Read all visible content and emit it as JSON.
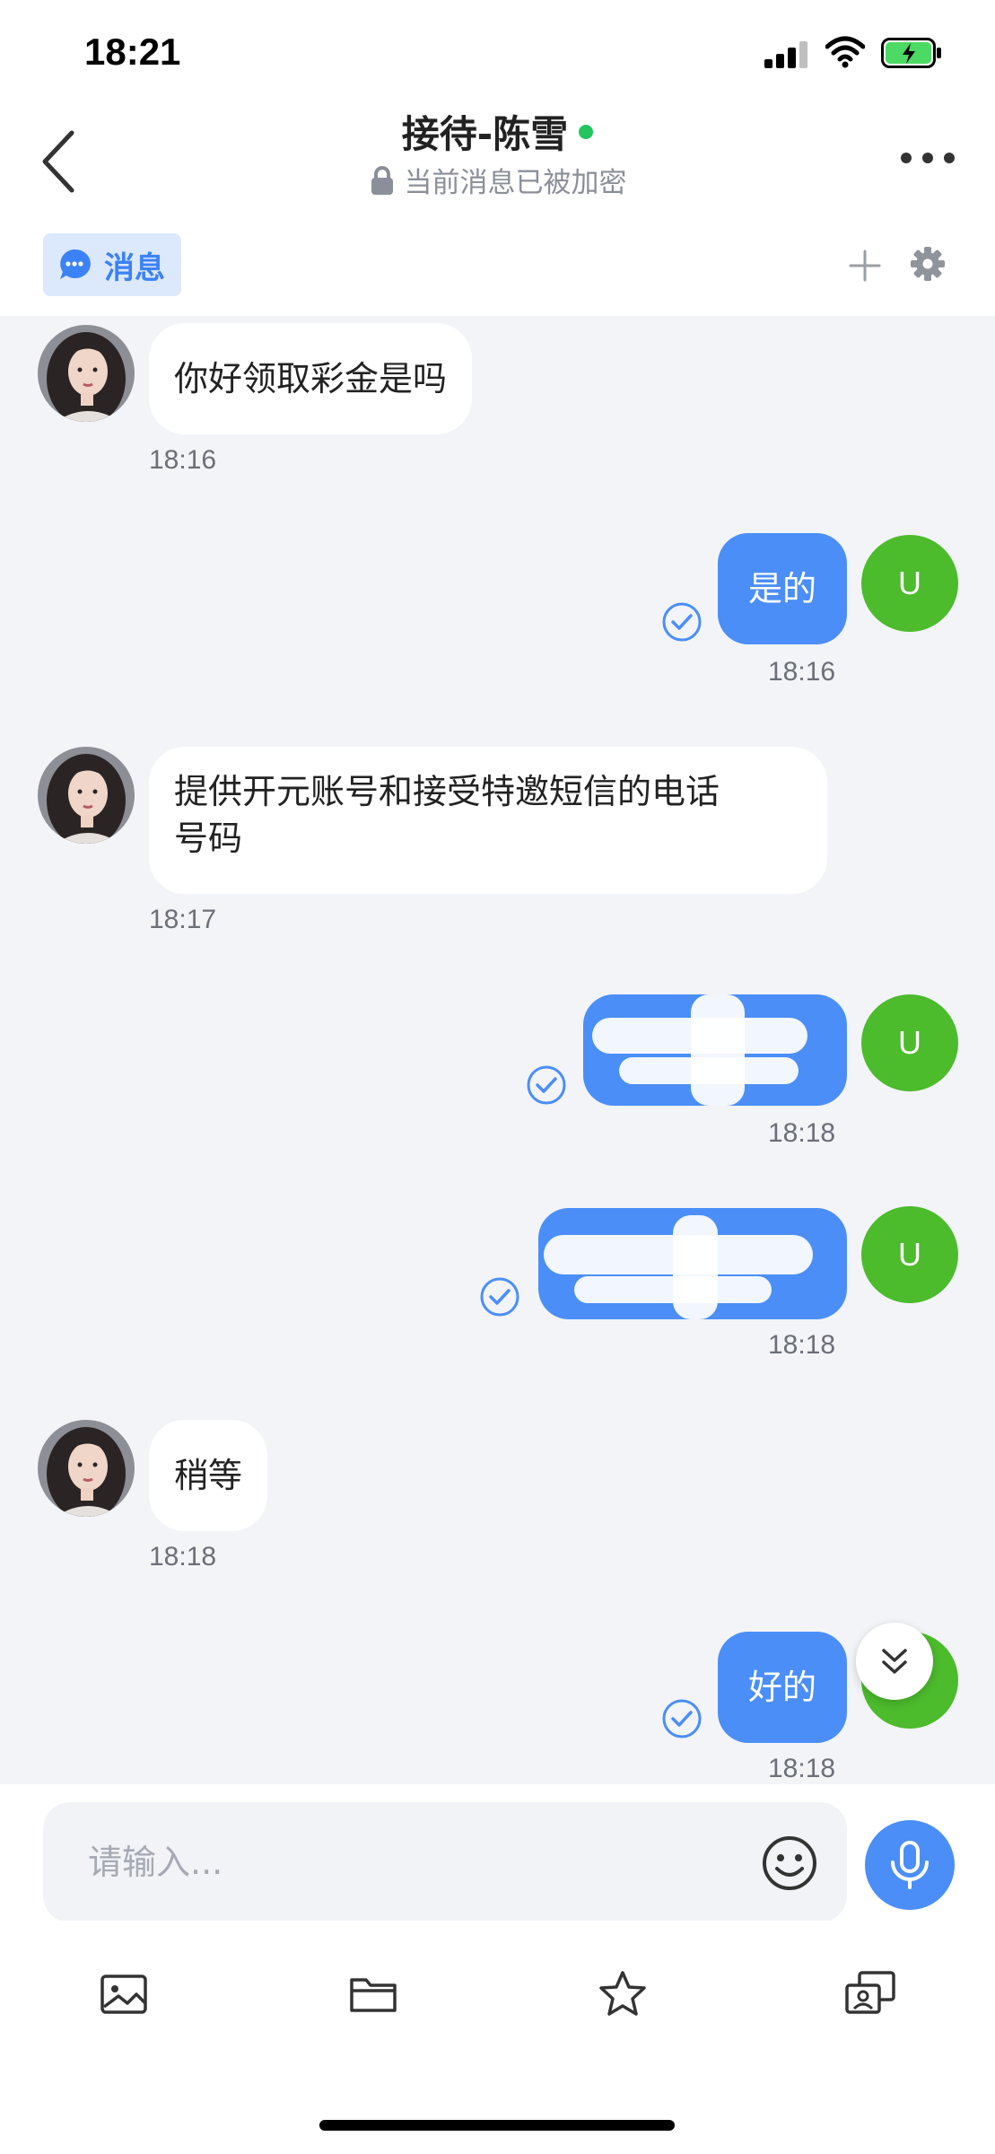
{
  "status_bar": {
    "time": "18:21"
  },
  "header": {
    "title": "接待-陈雪",
    "subtitle": "当前消息已被加密"
  },
  "tabs": {
    "active_label": "消息"
  },
  "messages": [
    {
      "side": "incoming",
      "text": "你好领取彩金是吗",
      "time": "18:16"
    },
    {
      "side": "outgoing",
      "text": "是的",
      "time": "18:16",
      "avatar_letter": "U"
    },
    {
      "side": "incoming",
      "text": "提供开元账号和接受特邀短信的电话号码",
      "text_line1": "提供开元账号和接受特邀短信的电话",
      "text_line2": "号码",
      "time": "18:17"
    },
    {
      "side": "outgoing",
      "text": "",
      "time": "18:18",
      "avatar_letter": "U",
      "redacted": true
    },
    {
      "side": "outgoing",
      "text": "",
      "time": "18:18",
      "avatar_letter": "U",
      "redacted": true
    },
    {
      "side": "incoming",
      "text": "稍等",
      "time": "18:18"
    },
    {
      "side": "outgoing",
      "text": "好的",
      "time": "18:18",
      "avatar_letter": "U"
    }
  ],
  "input": {
    "placeholder": "请输入..."
  },
  "colors": {
    "accent": "#4b8ef7",
    "user_avatar": "#4cbb2c",
    "online": "#22c55e",
    "chat_background": "#f3f4f8"
  },
  "icons": [
    "back-icon",
    "lock-icon",
    "more-icon",
    "chat-bubble-icon",
    "plus-icon",
    "gear-icon",
    "check-icon",
    "scroll-down-icon",
    "emoji-icon",
    "microphone-icon",
    "image-icon",
    "folder-icon",
    "star-icon",
    "contact-card-icon"
  ]
}
